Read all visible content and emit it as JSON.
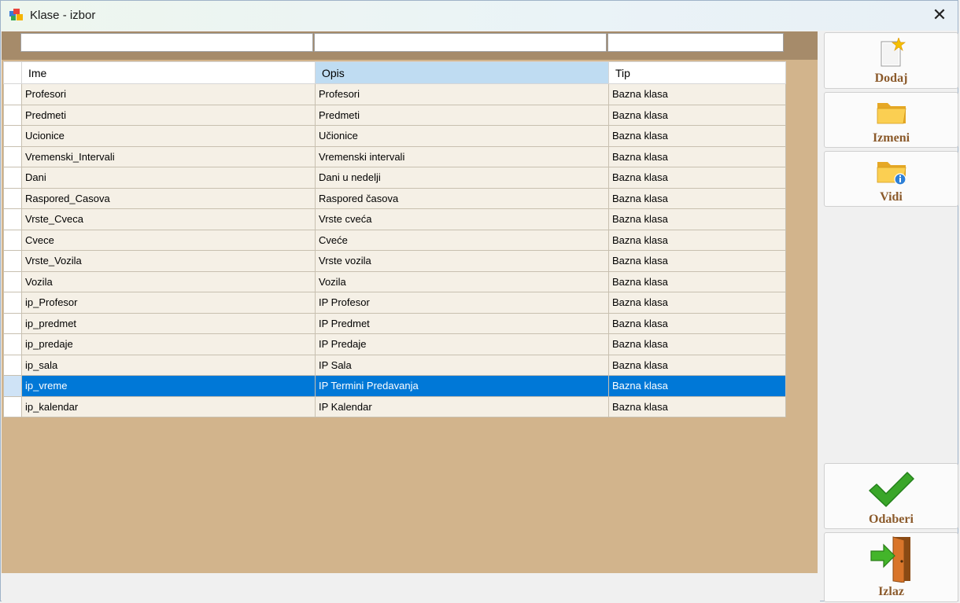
{
  "window": {
    "title": "Klase - izbor"
  },
  "filters": {
    "ime": "",
    "opis": "",
    "tip": ""
  },
  "table": {
    "columns": [
      "Ime",
      "Opis",
      "Tip"
    ],
    "sorted_column": "Opis",
    "selected_row_index": 14,
    "rows": [
      [
        "Profesori",
        "Profesori",
        "Bazna klasa"
      ],
      [
        "Predmeti",
        "Predmeti",
        "Bazna klasa"
      ],
      [
        "Ucionice",
        "Učionice",
        "Bazna klasa"
      ],
      [
        "Vremenski_Intervali",
        "Vremenski intervali",
        "Bazna klasa"
      ],
      [
        "Dani",
        "Dani u nedelji",
        "Bazna klasa"
      ],
      [
        "Raspored_Casova",
        "Raspored časova",
        "Bazna klasa"
      ],
      [
        "Vrste_Cveca",
        "Vrste cveća",
        "Bazna klasa"
      ],
      [
        "Cvece",
        "Cveće",
        "Bazna klasa"
      ],
      [
        "Vrste_Vozila",
        "Vrste vozila",
        "Bazna klasa"
      ],
      [
        "Vozila",
        "Vozila",
        "Bazna klasa"
      ],
      [
        "ip_Profesor",
        "IP Profesor",
        "Bazna klasa"
      ],
      [
        "ip_predmet",
        "IP Predmet",
        "Bazna klasa"
      ],
      [
        "ip_predaje",
        "IP Predaje",
        "Bazna klasa"
      ],
      [
        "ip_sala",
        "IP Sala",
        "Bazna klasa"
      ],
      [
        "ip_vreme",
        "IP Termini Predavanja",
        "Bazna klasa"
      ],
      [
        "ip_kalendar",
        "IP Kalendar",
        "Bazna klasa"
      ]
    ]
  },
  "buttons": {
    "dodaj": "Dodaj",
    "izmeni": "Izmeni",
    "vidi": "Vidi",
    "odaberi": "Odaberi",
    "izlaz": "Izlaz"
  },
  "icons": {
    "app": "app-window-icon",
    "close": "close-icon",
    "dodaj": "new-document-icon",
    "izmeni": "folder-icon",
    "vidi": "folder-info-icon",
    "odaberi": "checkmark-icon",
    "izlaz": "exit-door-icon"
  },
  "colors": {
    "panel_bg": "#d2b48c",
    "filter_band": "#a68b6a",
    "row_bg": "#f5f0e6",
    "selected_row": "#0078d7",
    "sorted_header": "#bfdcf2",
    "button_label": "#8b5a2b"
  }
}
